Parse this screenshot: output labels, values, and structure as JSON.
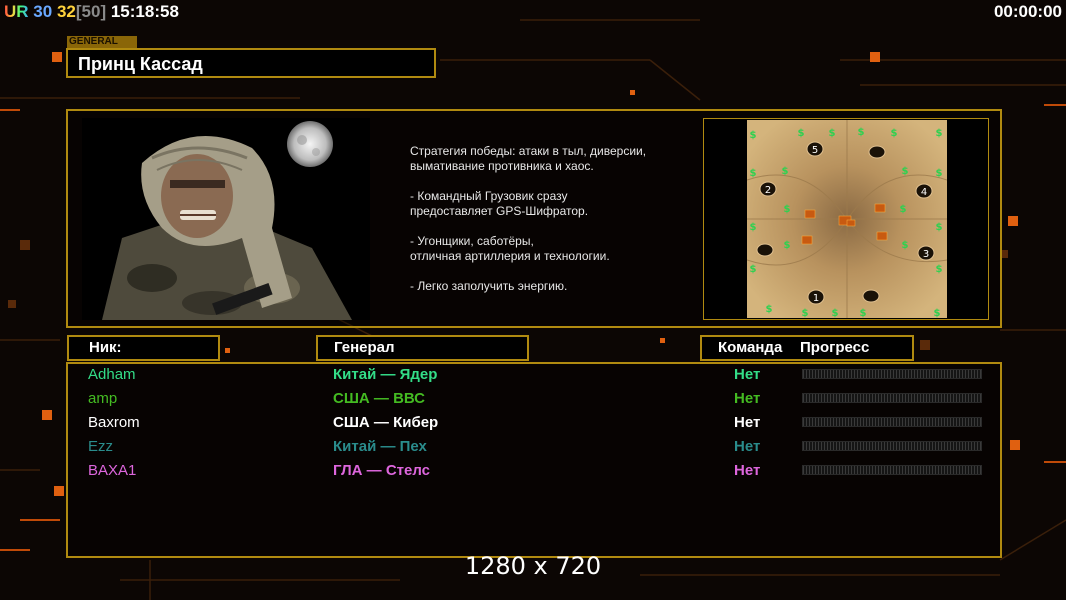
{
  "hud": {
    "tag": "UR",
    "num1": "30",
    "num2": "32",
    "num3": "[50]",
    "clock": "15:18:58",
    "timer": "00:00:00"
  },
  "general": {
    "tag": "GENERAL",
    "name": "Принц Кассад",
    "description": [
      "Стратегия победы: атаки в тыл, диверсии,\n вымативание противника и хаос.",
      "- Командный Грузовик сразу\nпредоставляет GPS-Шифратор.",
      "- Угонщики, саботёры,\nотличная артиллерия и технологии.",
      "- Легко заполучить энергию."
    ]
  },
  "map": {
    "start_positions": [
      "1",
      "2",
      "3",
      "4",
      "5"
    ]
  },
  "table": {
    "headers": {
      "nick": "Ник:",
      "general": "Генерал",
      "team": "Команда",
      "progress": "Прогресс"
    },
    "players": [
      {
        "nick": "Adham",
        "general": "Китай — Ядер",
        "team": "Нет",
        "color": "#33dd88",
        "progress": 0
      },
      {
        "nick": "amp",
        "general": "США — ВВС",
        "team": "Нет",
        "color": "#44bb22",
        "progress": 0
      },
      {
        "nick": "Baxrom",
        "general": "США — Кибер",
        "team": "Нет",
        "color": "#ffffff",
        "progress": 0
      },
      {
        "nick": "Ezz",
        "general": "Китай — Пех",
        "team": "Нет",
        "color": "#2a8c8c",
        "progress": 0
      },
      {
        "nick": "BAXA1",
        "general": "ГЛА — Стелс",
        "team": "Нет",
        "color": "#dd66dd",
        "progress": 0
      }
    ]
  },
  "resolution": "1280 x 720",
  "colors": {
    "frame": "#b08a10",
    "hud_tag": "#ffd23c",
    "hud_num1": "#6aa8ff",
    "hud_num2": "#ffd23c",
    "hud_num3": "#8a8a8a"
  }
}
